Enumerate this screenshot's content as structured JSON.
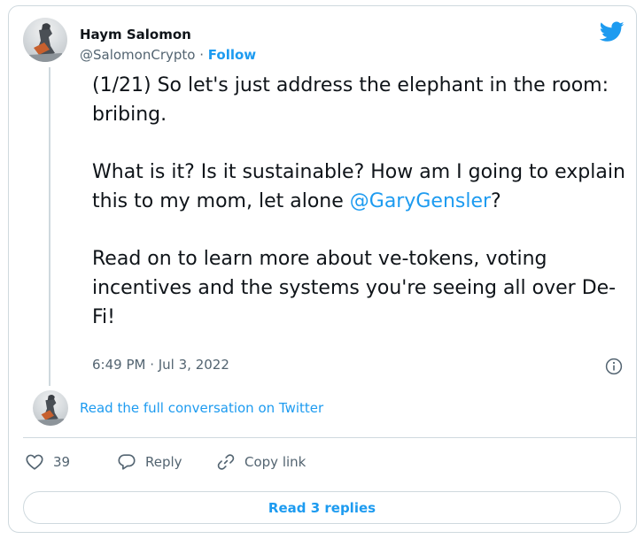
{
  "author": {
    "name": "Haym Salomon",
    "handle": "@SalomonCrypto",
    "separator": " · ",
    "follow_label": "Follow"
  },
  "tweet": {
    "para1": "(1/21) So let's just address the elephant in the room: bribing.",
    "para2_before": "What is it? Is it sustainable? How am I going to explain this to my mom, let alone ",
    "para2_mention": "@GaryGensler",
    "para2_after": "?",
    "para3": "Read on to learn more about ve-tokens, voting incentives and the systems you're seeing all over De-Fi!",
    "timestamp": "6:49 PM · Jul 3, 2022"
  },
  "conversation": {
    "read_full_label": "Read the full conversation on Twitter"
  },
  "actions": {
    "like_count": "39",
    "reply_label": "Reply",
    "copy_label": "Copy link",
    "read_replies_label": "Read 3 replies"
  },
  "icons": {
    "brand": "twitter-bird-icon",
    "info": "info-icon",
    "like": "heart-icon",
    "reply": "speech-bubble-icon",
    "copy": "link-icon"
  },
  "colors": {
    "accent": "#1d9bf0",
    "text": "#0f1419",
    "muted": "#536471",
    "border": "#cfd9de"
  }
}
